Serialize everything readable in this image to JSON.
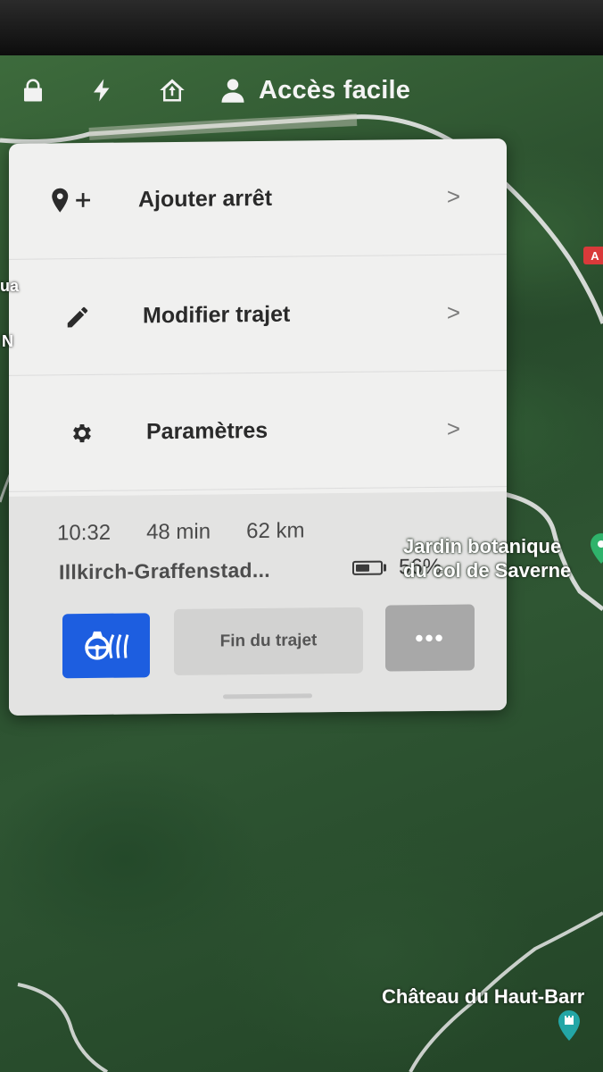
{
  "top_bar": {
    "icons": [
      "lock-icon",
      "bolt-icon",
      "home-arrow-icon",
      "person-icon"
    ],
    "profile_name": "Accès facile"
  },
  "menu": {
    "items": [
      {
        "icon": "pin-add-icon",
        "label": "Ajouter arrêt"
      },
      {
        "icon": "pencil-icon",
        "label": "Modifier trajet"
      },
      {
        "icon": "gear-icon",
        "label": "Paramètres"
      }
    ],
    "chevron": ">"
  },
  "trip": {
    "arrival_time": "10:32",
    "duration": "48 min",
    "distance": "62 km",
    "destination": "Illkirch-Graffenstad...",
    "battery_percent_label": "56%",
    "battery_level": 0.56,
    "end_trip_label": "Fin du trajet",
    "more_label": "•••",
    "autopilot_icon": "steering-wheel-icon"
  },
  "map": {
    "labels": {
      "jardin": "Jardin botanique du col de Saverne",
      "jardin_line1": "Jardin botanique",
      "jardin_line2": "du col de Saverne",
      "chateau": "Château du Haut-Barr",
      "edge_ua": "ua",
      "edge_n": "N",
      "road_badge": "A"
    },
    "colors": {
      "accent_blue": "#1d5ee0",
      "poi_green": "#2fb36b",
      "poi_teal": "#23a6a6"
    }
  }
}
